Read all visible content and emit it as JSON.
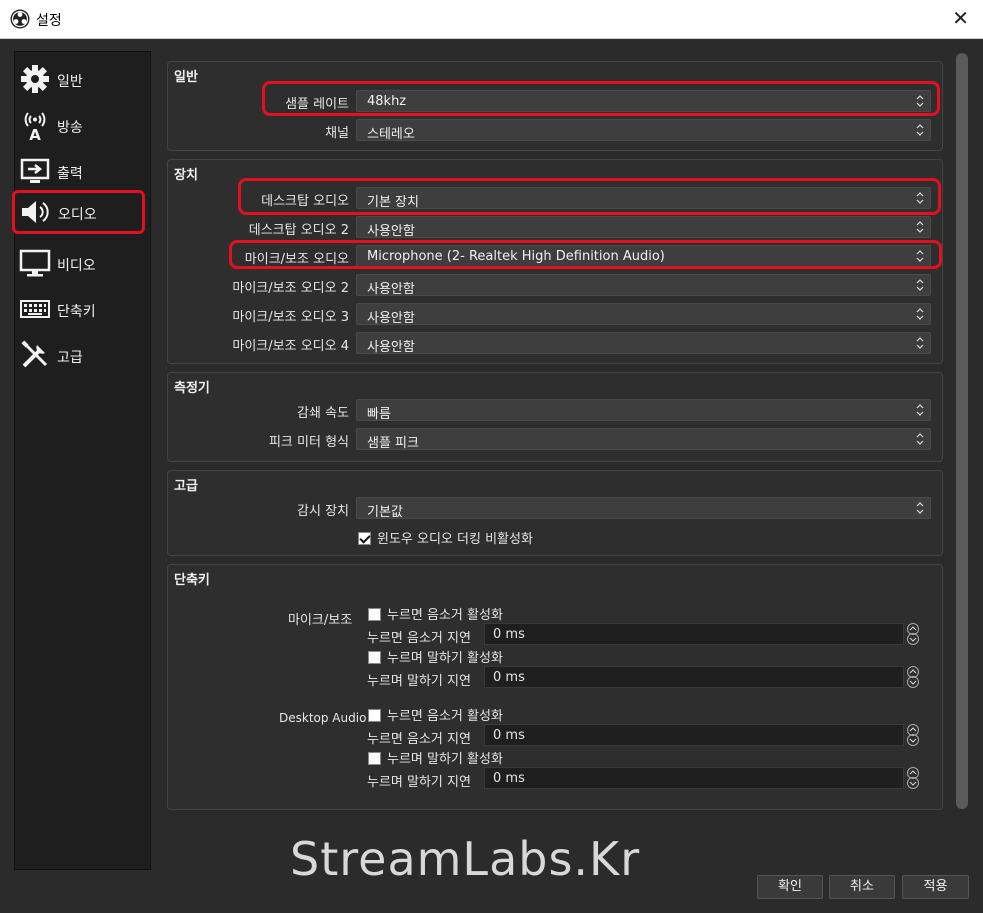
{
  "window": {
    "title": "설정"
  },
  "sidebar": {
    "items": [
      {
        "label": "일반",
        "icon": "gear-icon"
      },
      {
        "label": "방송",
        "icon": "broadcast-icon"
      },
      {
        "label": "출력",
        "icon": "output-icon"
      },
      {
        "label": "오디오",
        "icon": "speaker-icon",
        "selected": true
      },
      {
        "label": "비디오",
        "icon": "monitor-icon"
      },
      {
        "label": "단축키",
        "icon": "keyboard-icon"
      },
      {
        "label": "고급",
        "icon": "tools-icon"
      }
    ]
  },
  "general": {
    "title": "일반",
    "sample_rate_label": "샘플 레이트",
    "sample_rate_value": "48khz",
    "channel_label": "채널",
    "channel_value": "스테레오"
  },
  "devices": {
    "title": "장치",
    "rows": [
      {
        "label": "데스크탑 오디오",
        "value": "기본 장치"
      },
      {
        "label": "데스크탑 오디오 2",
        "value": "사용안함"
      },
      {
        "label": "마이크/보조 오디오",
        "value": "Microphone (2- Realtek High Definition Audio)"
      },
      {
        "label": "마이크/보조 오디오 2",
        "value": "사용안함"
      },
      {
        "label": "마이크/보조 오디오 3",
        "value": "사용안함"
      },
      {
        "label": "마이크/보조 오디오 4",
        "value": "사용안함"
      }
    ]
  },
  "meters": {
    "title": "측정기",
    "decay_label": "감쇄 속도",
    "decay_value": "빠름",
    "peak_label": "피크 미터 형식",
    "peak_value": "샘플 피크"
  },
  "advanced": {
    "title": "고급",
    "monitor_label": "감시 장치",
    "monitor_value": "기본값",
    "ducking_label": "윈도우 오디오 더킹 비활성화"
  },
  "hotkeys": {
    "title": "단축키",
    "groups": [
      {
        "name": "마이크/보조",
        "push_mute": "누르면 음소거 활성화",
        "push_mute_delay_label": "누르면 음소거 지연",
        "push_mute_delay": "0 ms",
        "push_talk": "누르며 말하기 활성화",
        "push_talk_delay_label": "누르며 말하기 지연",
        "push_talk_delay": "0 ms"
      },
      {
        "name": "Desktop Audio",
        "push_mute": "누르면 음소거 활성화",
        "push_mute_delay_label": "누르면 음소거 지연",
        "push_mute_delay": "0 ms",
        "push_talk": "누르며 말하기 활성화",
        "push_talk_delay_label": "누르며 말하기 지연",
        "push_talk_delay": "0 ms"
      }
    ]
  },
  "watermark": "StreamLabs.Kr",
  "buttons": {
    "ok": "확인",
    "cancel": "취소",
    "apply": "적용"
  },
  "colors": {
    "highlight": "#e3101f",
    "background": "#2b2b2b",
    "sidebar": "#1e1e1e"
  }
}
